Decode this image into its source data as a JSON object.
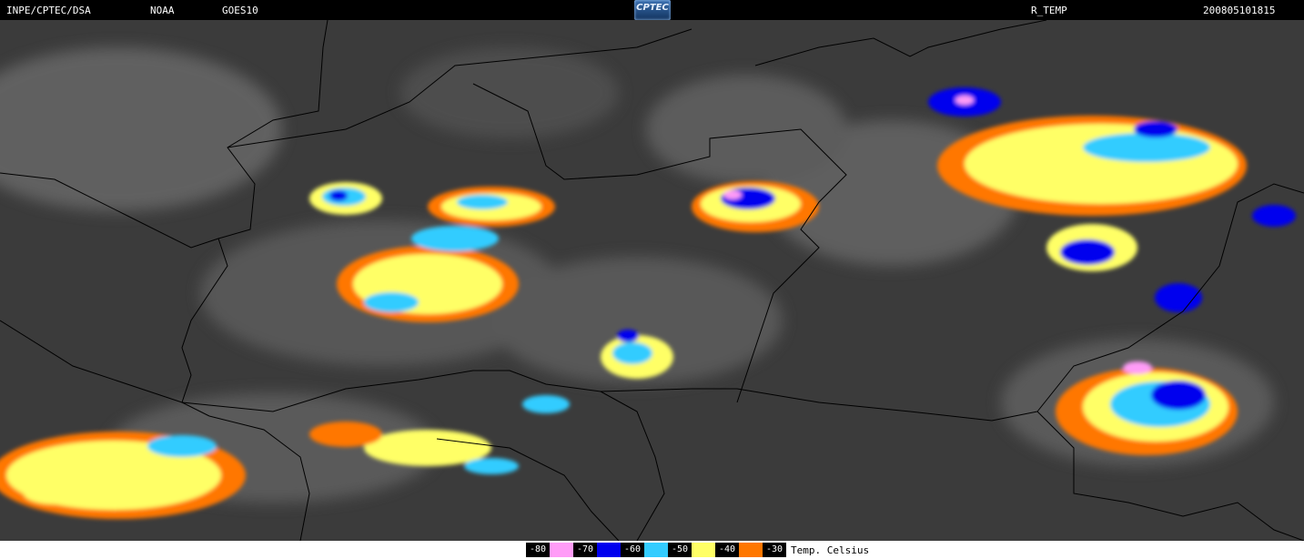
{
  "header": {
    "source": "INPE/CPTEC/DSA",
    "agency": "NOAA",
    "satellite": "GOES10",
    "product": "R_TEMP",
    "datetime": "200805101815",
    "logo": "CPTEC"
  },
  "legend": {
    "unit": "Temp. Celsius",
    "items": [
      {
        "label": "-80",
        "color": "#ff9cf7"
      },
      {
        "label": "-70",
        "color": "#0000ee"
      },
      {
        "label": "-60",
        "color": "#33ccff"
      },
      {
        "label": "-50",
        "color": "#ffff66"
      },
      {
        "label": "-40",
        "color": "#ff7700"
      },
      {
        "label": "-30",
        "color": "#ff7700"
      }
    ]
  },
  "colors": {
    "background_ir": "#3b3b3b",
    "cloud_ir": "#8a8a8a",
    "border": "#000000"
  }
}
